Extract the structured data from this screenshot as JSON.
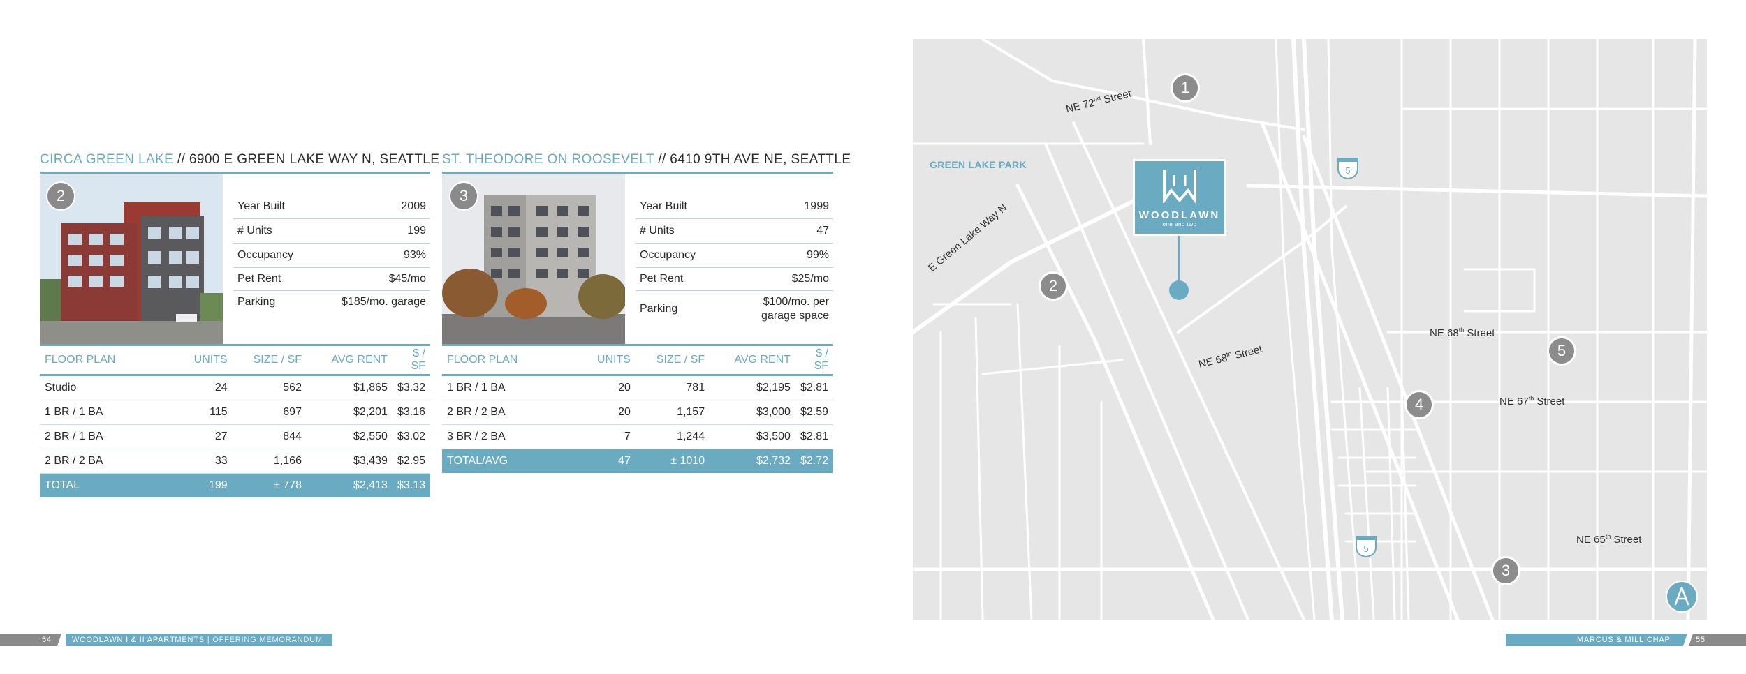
{
  "left_property": {
    "name": "CIRCA GREEN LAKE",
    "address": " // 6900 E GREEN LAKE WAY N, SEATTLE",
    "badge": "2",
    "facts": [
      {
        "label": "Year Built",
        "value": "2009"
      },
      {
        "label": "# Units",
        "value": "199"
      },
      {
        "label": "Occupancy",
        "value": "93%"
      },
      {
        "label": "Pet Rent",
        "value": "$45/mo"
      },
      {
        "label": "Parking",
        "value": "$185/mo. garage"
      }
    ],
    "headers": [
      "FLOOR PLAN",
      "UNITS",
      "SIZE / SF",
      "AVG RENT",
      "$ / SF"
    ],
    "rows": [
      [
        "Studio",
        "24",
        "562",
        "$1,865",
        "$3.32"
      ],
      [
        "1 BR / 1 BA",
        "115",
        "697",
        "$2,201",
        "$3.16"
      ],
      [
        "2 BR / 1 BA",
        "27",
        "844",
        "$2,550",
        "$3.02"
      ],
      [
        "2 BR / 2 BA",
        "33",
        "1,166",
        "$3,439",
        "$2.95"
      ]
    ],
    "total": [
      "TOTAL",
      "199",
      "± 778",
      "$2,413",
      "$3.13"
    ]
  },
  "right_property": {
    "name": "ST. THEODORE ON ROOSEVELT",
    "address": " // 6410 9TH AVE NE, SEATTLE",
    "badge": "3",
    "facts": [
      {
        "label": "Year Built",
        "value": "1999"
      },
      {
        "label": "# Units",
        "value": "47"
      },
      {
        "label": "Occupancy",
        "value": "99%"
      },
      {
        "label": "Pet Rent",
        "value": "$25/mo"
      },
      {
        "label": "Parking",
        "value": "$100/mo. per garage space"
      }
    ],
    "headers": [
      "FLOOR PLAN",
      "UNITS",
      "SIZE / SF",
      "AVG RENT",
      "$ / SF"
    ],
    "rows": [
      [
        "1 BR / 1 BA",
        "20",
        "781",
        "$2,195",
        "$2.81"
      ],
      [
        "2 BR / 2 BA",
        "20",
        "1,157",
        "$3,000",
        "$2.59"
      ],
      [
        "3 BR / 2 BA",
        "7",
        "1,244",
        "$3,500",
        "$2.81"
      ]
    ],
    "total": [
      "TOTAL/AVG",
      "47",
      "± 1010",
      "$2,732",
      "$2.72"
    ]
  },
  "map": {
    "park_label": "GREEN LAKE PARK",
    "streets": {
      "ne72": "NE 72",
      "ne72_sup": "nd",
      "ne72_rest": " Street",
      "egreenlake": "E Green Lake Way N",
      "ne68a": "NE 68",
      "ne68a_sup": "th",
      "ne68a_rest": " Street",
      "ne68b": "NE 68",
      "ne68b_sup": "th",
      "ne68b_rest": " Street",
      "ne67": "NE 67",
      "ne67_sup": "th",
      "ne67_rest": " Street",
      "ne65": "NE 65",
      "ne65_sup": "th",
      "ne65_rest": " Street"
    },
    "badges": [
      "1",
      "2",
      "3",
      "4",
      "5"
    ],
    "interstate": "5",
    "logo_word": "WOODLAWN",
    "logo_sub": "one and two",
    "compass_icon": "north-arrow-icon"
  },
  "footer": {
    "left_page": "54",
    "left_text": "WOODLAWN I & II APARTMENTS",
    "left_text_b": " | OFFERING MEMORANDUM",
    "right_text": "MARCUS & MILLICHAP",
    "right_page": "55"
  },
  "colors": {
    "accent": "#6aabc2",
    "grey": "#8a8a8a",
    "map_bg": "#e6e6e6"
  }
}
